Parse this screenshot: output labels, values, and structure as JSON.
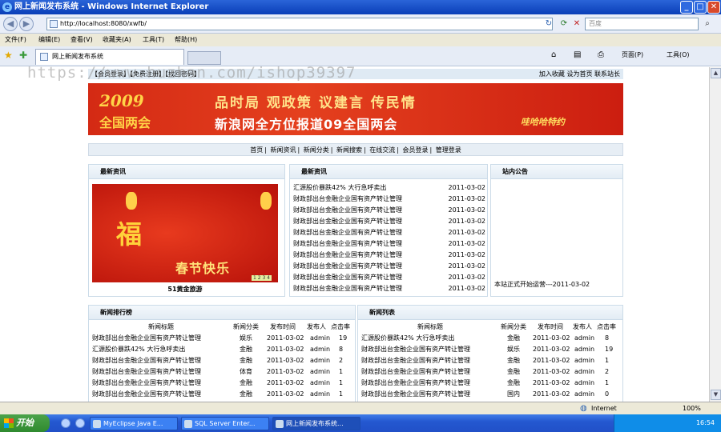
{
  "window": {
    "title": "网上新闻发布系统 - Windows Internet Explorer",
    "controls": [
      "_",
      "□",
      "✕"
    ]
  },
  "address_bar": {
    "url": "http://localhost:8080/xwfb/",
    "search_placeholder": "百度"
  },
  "menu": [
    "文件(F)",
    "编辑(E)",
    "查看(V)",
    "收藏夹(A)",
    "工具(T)",
    "帮助(H)"
  ],
  "tab": {
    "label": "网上新闻发布系统"
  },
  "toolbar_right": {
    "page": "页面(P)",
    "tools": "工具(O)"
  },
  "watermark": "https://www.huzhan.com/ishop39397",
  "site": {
    "top_left": "【会员登录】【免费注册】【找回密码】",
    "top_right": "加入收藏  设为首页  联系站长",
    "banner": {
      "year": "2009",
      "year_sub": "全国两会",
      "line1": "品时局 观政策 议建言 传民情",
      "line2": "新浪网全方位报道09全国两会",
      "mascot": "哇哈哈特约"
    },
    "nav": [
      "首页",
      "新闻资讯",
      "新闻分类",
      "新闻搜索",
      "在线交流",
      "会员登录",
      "管理登录"
    ],
    "panel_latest_img": {
      "title": "最新资讯",
      "image_text_main": "福",
      "image_text_sub": "春节快乐",
      "image_pager": "1 2 3 4",
      "caption": "51黄金旅游"
    },
    "panel_latest_list": {
      "title": "最新资讯",
      "items": [
        {
          "title": "汇源股价暴跌42% 大行急呼卖出",
          "date": "2011-03-02"
        },
        {
          "title": "财政部出台金融企业国有资产转让管理",
          "date": "2011-03-02"
        },
        {
          "title": "财政部出台金融企业国有资产转让管理",
          "date": "2011-03-02"
        },
        {
          "title": "财政部出台金融企业国有资产转让管理",
          "date": "2011-03-02"
        },
        {
          "title": "财政部出台金融企业国有资产转让管理",
          "date": "2011-03-02"
        },
        {
          "title": "财政部出台金融企业国有资产转让管理",
          "date": "2011-03-02"
        },
        {
          "title": "财政部出台金融企业国有资产转让管理",
          "date": "2011-03-02"
        },
        {
          "title": "财政部出台金融企业国有资产转让管理",
          "date": "2011-03-02"
        },
        {
          "title": "财政部出台金融企业国有资产转让管理",
          "date": "2011-03-02"
        },
        {
          "title": "财政部出台金融企业国有资产转让管理",
          "date": "2011-03-02"
        }
      ]
    },
    "panel_notice": {
      "title": "站内公告",
      "text": "本站正式开始运营---2011-03-02"
    },
    "rank_table": {
      "title": "新闻排行榜",
      "headers": [
        "新闻标题",
        "新闻分类",
        "发布时间",
        "发布人",
        "点击率"
      ],
      "rows": [
        [
          "财政部出台金融企业国有资产转让管理",
          "娱乐",
          "2011-03-02",
          "admin",
          "19"
        ],
        [
          "汇源股价暴跌42% 大行急呼卖出",
          "金融",
          "2011-03-02",
          "admin",
          "8"
        ],
        [
          "财政部出台金融企业国有资产转让管理",
          "金融",
          "2011-03-02",
          "admin",
          "2"
        ],
        [
          "财政部出台金融企业国有资产转让管理",
          "体育",
          "2011-03-02",
          "admin",
          "1"
        ],
        [
          "财政部出台金融企业国有资产转让管理",
          "金融",
          "2011-03-02",
          "admin",
          "1"
        ],
        [
          "财政部出台金融企业国有资产转让管理",
          "金融",
          "2011-03-02",
          "admin",
          "1"
        ]
      ]
    },
    "list_table": {
      "title": "新闻列表",
      "headers": [
        "新闻标题",
        "新闻分类",
        "发布时间",
        "发布人",
        "点击率"
      ],
      "rows": [
        [
          "汇源股价暴跌42% 大行急呼卖出",
          "金融",
          "2011-03-02",
          "admin",
          "8"
        ],
        [
          "财政部出台金融企业国有资产转让管理",
          "娱乐",
          "2011-03-02",
          "admin",
          "19"
        ],
        [
          "财政部出台金融企业国有资产转让管理",
          "金融",
          "2011-03-02",
          "admin",
          "1"
        ],
        [
          "财政部出台金融企业国有资产转让管理",
          "金融",
          "2011-03-02",
          "admin",
          "2"
        ],
        [
          "财政部出台金融企业国有资产转让管理",
          "金融",
          "2011-03-02",
          "admin",
          "1"
        ],
        [
          "财政部出台金融企业国有资产转让管理",
          "国内",
          "2011-03-02",
          "admin",
          "0"
        ]
      ]
    }
  },
  "statusbar": {
    "zone": "Internet",
    "zoom": "100%"
  },
  "taskbar": {
    "start": "开始",
    "tasks": [
      "MyEclipse Java E...",
      "SQL Server Enter...",
      "网上新闻发布系统..."
    ],
    "clock": "16:54"
  }
}
